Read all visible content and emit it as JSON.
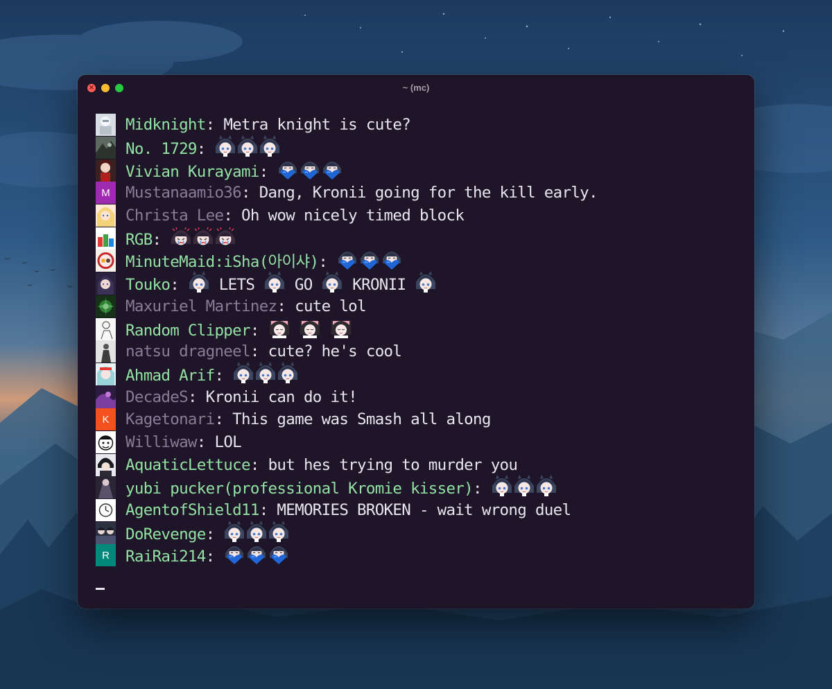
{
  "window": {
    "title": "~ (mc)"
  },
  "chat": [
    {
      "avatar": "avatar-white-robot",
      "name": "Midknight",
      "color": "green",
      "parts": [
        {
          "t": "Metra knight is cute?"
        }
      ]
    },
    {
      "avatar": "avatar-dark-art",
      "name": "No. 1729",
      "color": "green",
      "parts": [
        {
          "e": "kronii-face-emote"
        },
        {
          "e": "kronii-face-emote"
        },
        {
          "e": "kronii-face-emote"
        }
      ]
    },
    {
      "avatar": "avatar-red-anime",
      "name": "Vivian Kurayami",
      "color": "green",
      "parts": [
        {
          "e": "kronii-heart-emote"
        },
        {
          "e": "kronii-heart-emote"
        },
        {
          "e": "kronii-heart-emote"
        }
      ]
    },
    {
      "avatar": "avatar-letter-M",
      "name": "Mustanaamio36",
      "color": "muted",
      "parts": [
        {
          "t": "Dang, Kronii going for the kill early."
        }
      ]
    },
    {
      "avatar": "avatar-blonde-anime",
      "name": "Christa Lee",
      "color": "muted",
      "parts": [
        {
          "t": "Oh wow nicely timed block"
        }
      ]
    },
    {
      "avatar": "avatar-rgb-bars",
      "name": "RGB",
      "color": "green",
      "parts": [
        {
          "e": "kronii-cry-emote"
        },
        {
          "e": "kronii-cry-emote"
        },
        {
          "e": "kronii-cry-emote"
        }
      ]
    },
    {
      "avatar": "avatar-logo-badge",
      "name": "MinuteMaid:iSha(아이샤)",
      "color": "green",
      "parts": [
        {
          "e": "kronii-heart-emote"
        },
        {
          "e": "kronii-heart-emote"
        },
        {
          "e": "kronii-heart-emote"
        }
      ]
    },
    {
      "avatar": "avatar-dark-anime",
      "name": "Touko",
      "color": "green",
      "parts": [
        {
          "e": "kronii-face-emote"
        },
        {
          "t": " LETS "
        },
        {
          "e": "kronii-face-emote"
        },
        {
          "t": " GO "
        },
        {
          "e": "kronii-face-emote"
        },
        {
          "t": " KRONII "
        },
        {
          "e": "kronii-face-emote"
        }
      ]
    },
    {
      "avatar": "avatar-green-star",
      "name": "Maxuriel Martinez",
      "color": "muted",
      "parts": [
        {
          "t": "cute lol"
        }
      ]
    },
    {
      "avatar": "avatar-sketch",
      "name": "Random Clipper",
      "color": "green",
      "parts": [
        {
          "e": "kronii-sleepy-emote"
        },
        {
          "t": " "
        },
        {
          "e": "kronii-sleepy-emote"
        },
        {
          "t": " "
        },
        {
          "e": "kronii-sleepy-emote"
        }
      ]
    },
    {
      "avatar": "avatar-grey-figure",
      "name": "natsu dragneel",
      "color": "muted",
      "parts": [
        {
          "t": "cute? he's cool"
        }
      ]
    },
    {
      "avatar": "avatar-teal-anime",
      "name": "Ahmad Arif",
      "color": "green",
      "parts": [
        {
          "e": "kronii-face-emote"
        },
        {
          "e": "kronii-face-emote"
        },
        {
          "e": "kronii-face-emote"
        }
      ]
    },
    {
      "avatar": "avatar-purple-swirl",
      "name": "DecadeS",
      "color": "muted",
      "parts": [
        {
          "t": "Kronii can do it!"
        }
      ]
    },
    {
      "avatar": "avatar-letter-K",
      "name": "Kagetonari",
      "color": "muted",
      "parts": [
        {
          "t": "This game was Smash all along"
        }
      ]
    },
    {
      "avatar": "avatar-cartoon-face",
      "name": "Williwaw",
      "color": "muted",
      "parts": [
        {
          "t": "LOL"
        }
      ]
    },
    {
      "avatar": "avatar-dark-anime-boy",
      "name": "AquaticLettuce",
      "color": "green",
      "parts": [
        {
          "t": "but hes trying to murder you"
        }
      ]
    },
    {
      "avatar": "avatar-dark-figure",
      "name": "yubi pucker(professional Kromie kisser)",
      "color": "green",
      "parts": [
        {
          "e": "kronii-face-emote"
        },
        {
          "e": "kronii-face-emote"
        },
        {
          "e": "kronii-face-emote"
        }
      ]
    },
    {
      "avatar": "avatar-clock",
      "name": "AgentofShield11",
      "color": "green",
      "parts": [
        {
          "t": "MEMORIES BROKEN - wait wrong duel"
        }
      ]
    },
    {
      "avatar": "avatar-group-anime",
      "name": "DoRevenge",
      "color": "green",
      "parts": [
        {
          "e": "kronii-face-emote"
        },
        {
          "e": "kronii-face-emote"
        },
        {
          "e": "kronii-face-emote"
        }
      ]
    },
    {
      "avatar": "avatar-letter-R",
      "name": "RaiRai214",
      "color": "green",
      "parts": [
        {
          "e": "kronii-heart-emote"
        },
        {
          "e": "kronii-heart-emote"
        },
        {
          "e": "kronii-heart-emote"
        }
      ]
    }
  ],
  "separator": ": ",
  "letters": {
    "M": "M",
    "K": "K",
    "R": "R"
  },
  "colors": {
    "window_bg": "#1e1628",
    "name_green": "#94e1a4",
    "name_muted": "#8a7b98",
    "message_text": "#e9e6ef",
    "title_text": "#a59fae",
    "avatar_M": "#9f2bb2",
    "avatar_K": "#f4511e",
    "avatar_R": "#00897b"
  }
}
